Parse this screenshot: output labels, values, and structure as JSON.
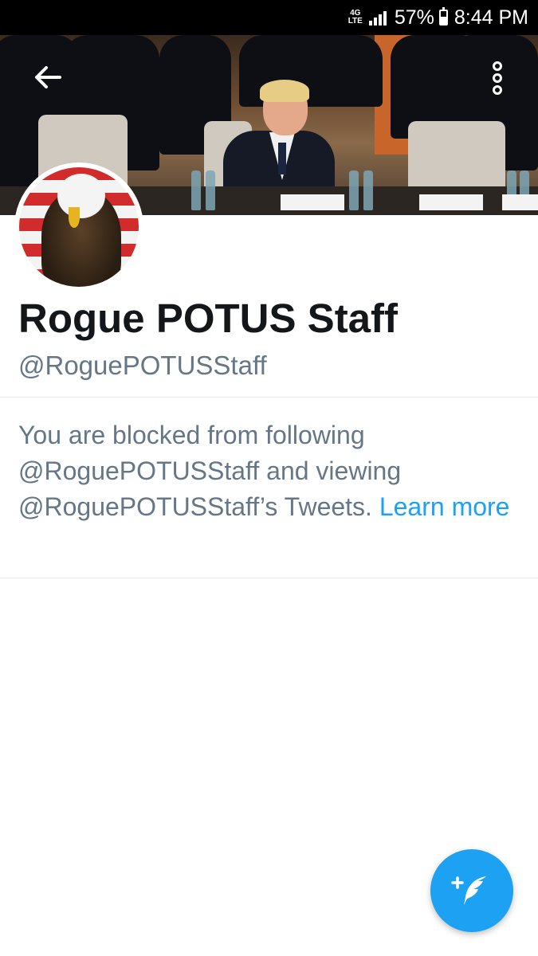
{
  "status_bar": {
    "network": "4G LTE",
    "battery_percent": "57%",
    "battery_level": 0.57,
    "time": "8:44 PM"
  },
  "header": {
    "back_icon": "arrow-left-icon",
    "menu_icon": "vertical-dots-icon"
  },
  "profile": {
    "display_name": "Rogue POTUS Staff",
    "handle": "@RoguePOTUSStaff"
  },
  "blocked_notice": {
    "message": "You are blocked from following @RoguePOTUSStaff and viewing @RoguePOTUSStaff’s Tweets.",
    "link_label": "Learn more"
  },
  "compose_fab": {
    "icon": "compose-tweet-icon"
  },
  "colors": {
    "accent": "#1da1f2",
    "secondary_text": "#657786",
    "primary_text": "#14171a",
    "divider": "#e1e8ed"
  }
}
